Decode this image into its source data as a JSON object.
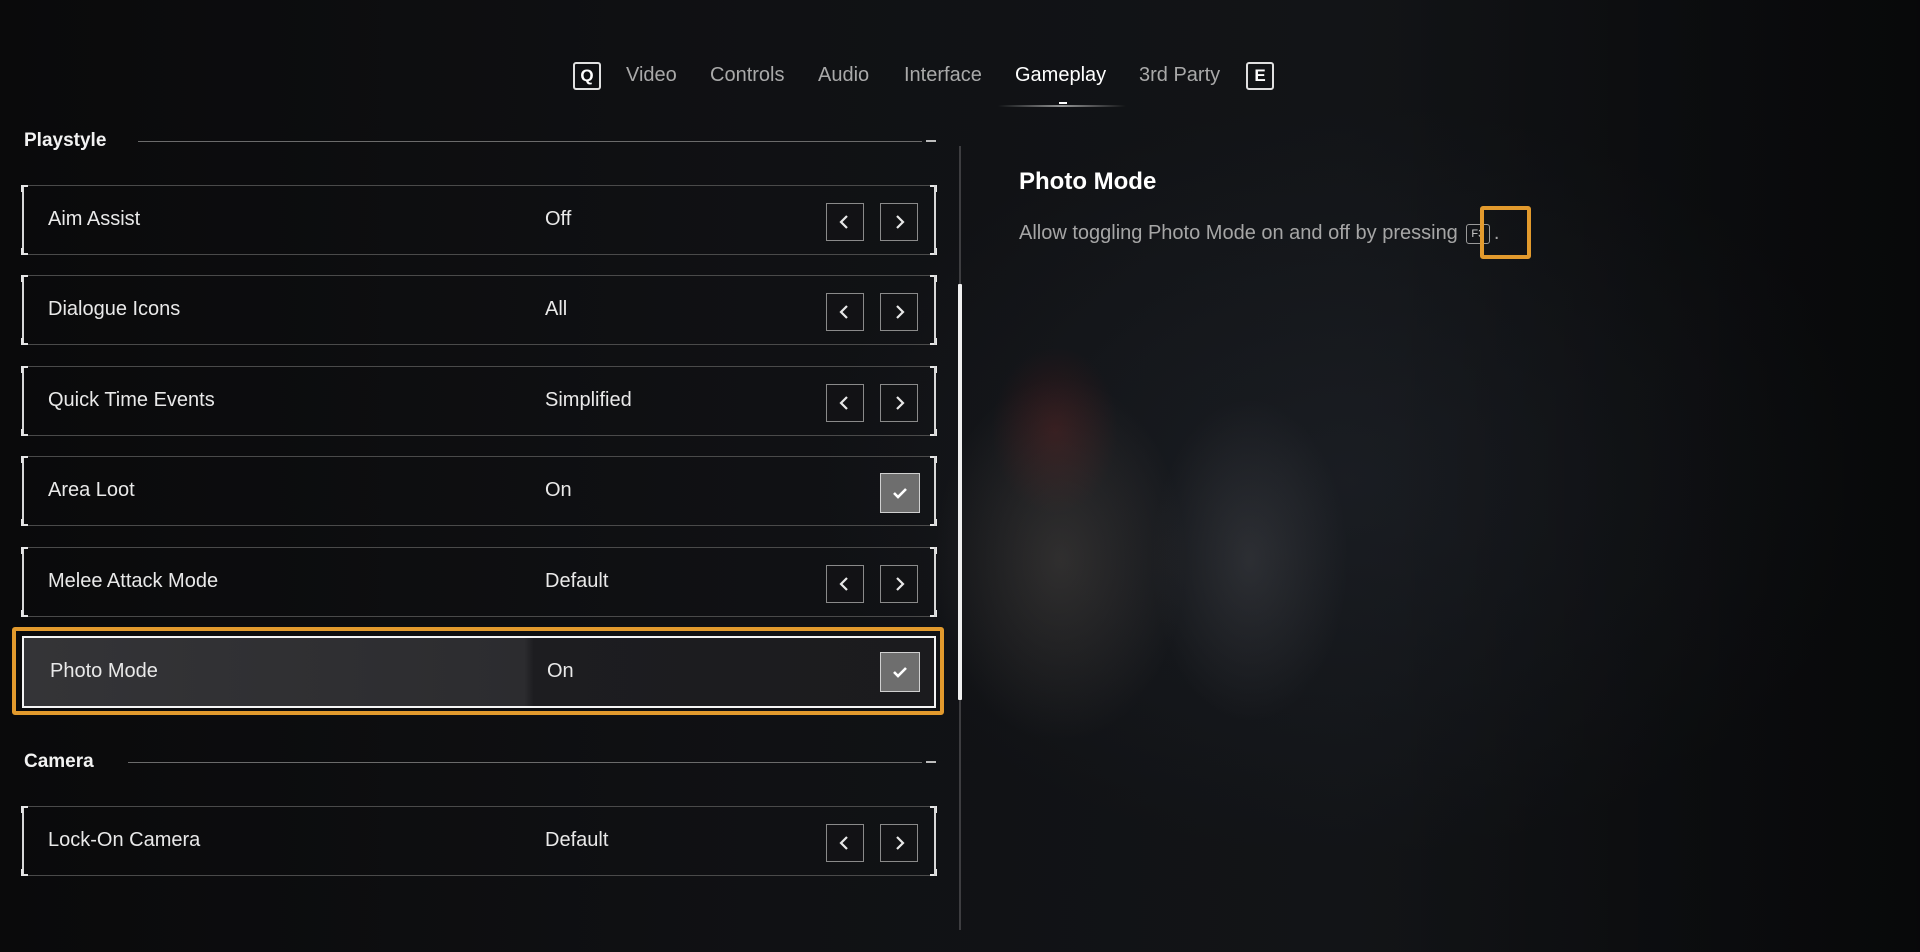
{
  "tabs": {
    "prev_key": "Q",
    "next_key": "E",
    "items": [
      {
        "label": "Video"
      },
      {
        "label": "Controls"
      },
      {
        "label": "Audio"
      },
      {
        "label": "Interface"
      },
      {
        "label": "Gameplay"
      },
      {
        "label": "3rd Party"
      }
    ],
    "active": "Gameplay"
  },
  "sections": {
    "playstyle": {
      "title": "Playstyle",
      "rows": [
        {
          "label": "Aim Assist",
          "value": "Off",
          "control": "arrows"
        },
        {
          "label": "Dialogue Icons",
          "value": "All",
          "control": "arrows"
        },
        {
          "label": "Quick Time Events",
          "value": "Simplified",
          "control": "arrows"
        },
        {
          "label": "Area Loot",
          "value": "On",
          "control": "checkbox",
          "checked": true
        },
        {
          "label": "Melee Attack Mode",
          "value": "Default",
          "control": "arrows"
        },
        {
          "label": "Photo Mode",
          "value": "On",
          "control": "checkbox",
          "checked": true,
          "selected": true
        }
      ]
    },
    "camera": {
      "title": "Camera",
      "rows": [
        {
          "label": "Lock-On Camera",
          "value": "Default",
          "control": "arrows"
        }
      ]
    }
  },
  "description": {
    "title": "Photo Mode",
    "text_before": "Allow toggling Photo Mode on and off by pressing",
    "key": "F3",
    "text_after": "."
  },
  "colors": {
    "highlight": "#e29a2d",
    "background": "#0b0b0c",
    "text": "#e9e9e9",
    "muted_text": "#a6a6a6"
  }
}
